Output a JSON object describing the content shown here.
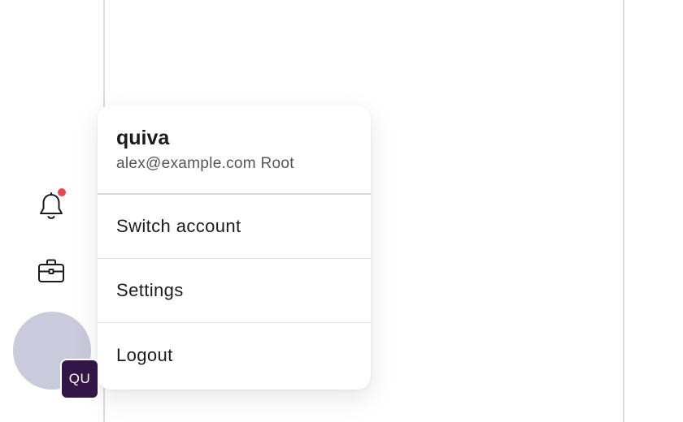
{
  "account_menu": {
    "account_name": "quiva",
    "account_email": "alex@example.com",
    "account_role": "Root",
    "items": [
      {
        "label": "Switch account"
      },
      {
        "label": "Settings"
      },
      {
        "label": "Logout"
      }
    ]
  },
  "rail": {
    "icons": [
      "bell-icon",
      "briefcase-icon"
    ],
    "notification_dot_color": "#e5484d",
    "avatar_color": "#c9cadc",
    "org_badge": {
      "initials": "QU",
      "color": "#341548"
    }
  }
}
